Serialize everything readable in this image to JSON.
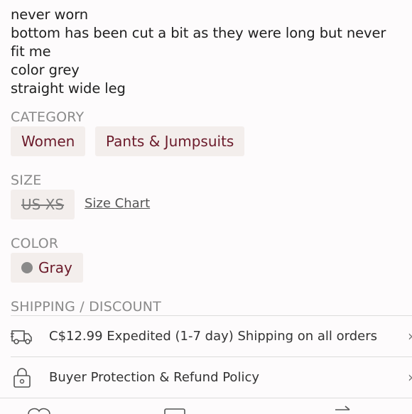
{
  "description": {
    "lines": [
      "never worn",
      "bottom has been cut a bit as they were long but never",
      "fit me",
      "color grey",
      "straight wide leg"
    ]
  },
  "category": {
    "title": "CATEGORY",
    "chips": [
      "Women",
      "Pants & Jumpsuits"
    ]
  },
  "size": {
    "title": "SIZE",
    "value": "US XS",
    "size_chart_link": "Size Chart"
  },
  "color": {
    "title": "COLOR",
    "value": "Gray",
    "swatch": "#8a8a8a"
  },
  "shipping": {
    "title": "SHIPPING / DISCOUNT",
    "rows": [
      {
        "icon": "truck-icon",
        "label": "C$12.99 Expedited (1-7 day) Shipping on all orders"
      },
      {
        "icon": "lock-icon",
        "label": "Buyer Protection & Refund Policy"
      }
    ]
  },
  "colors": {
    "accent_text": "#6b1a2a",
    "chip_bg": "#f3eeec",
    "muted": "#8a8a8a"
  }
}
